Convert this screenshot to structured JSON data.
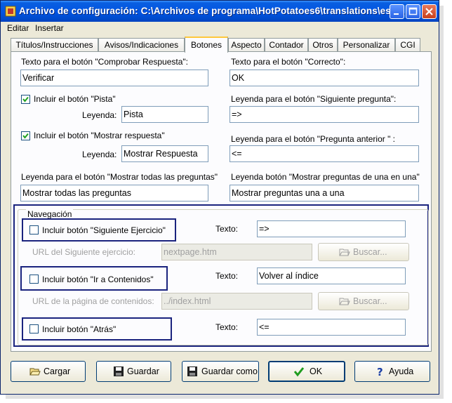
{
  "window": {
    "title": "Archivo de configuración: C:\\Archivos de programa\\HotPotatoes6\\translations\\esp...",
    "controls": [
      "minimize",
      "maximize",
      "close"
    ]
  },
  "menu": {
    "items": [
      "Editar",
      "Insertar"
    ]
  },
  "tabs": [
    {
      "label": "Títulos/Instrucciones"
    },
    {
      "label": "Avisos/Indicaciones"
    },
    {
      "label": "Botones",
      "active": true
    },
    {
      "label": "Aspecto"
    },
    {
      "label": "Contador"
    },
    {
      "label": "Otros"
    },
    {
      "label": "Personalizar"
    },
    {
      "label": "CGI"
    }
  ],
  "buttons_tab": {
    "check_button_label": "Texto para el botón \"Comprobar Respuesta\":",
    "check_button_value": "Verificar",
    "correct_button_label": "Texto para el botón \"Correcto\":",
    "correct_button_value": "OK",
    "hint_checkbox_label": "Incluir el botón \"Pista\"",
    "hint_checked": true,
    "hint_caption_label": "Leyenda:",
    "hint_caption_value": "Pista",
    "next_question_label": "Leyenda para el botón \"Siguiente pregunta\":",
    "next_question_value": "=>",
    "show_answer_checkbox_label": "Incluir el botón \"Mostrar respuesta\"",
    "show_answer_checked": true,
    "show_answer_caption_label": "Leyenda:",
    "show_answer_caption_value": "Mostrar Respuesta",
    "prev_question_label": "Leyenda para el botón \"Pregunta anterior \" :",
    "prev_question_value": "<=",
    "show_all_label": "Leyenda para el botón \"Mostrar todas las preguntas\"",
    "show_all_value": "Mostrar todas las preguntas",
    "show_one_label": "Leyenda botón \"Mostrar preguntas de una en una\"",
    "show_one_value": "Mostrar preguntas una a una"
  },
  "navigation": {
    "group_title": "Navegación",
    "next_exercise_checkbox": "Incluir botón \"Siguiente Ejercicio\"",
    "next_exercise_checked": false,
    "next_exercise_text_label": "Texto:",
    "next_exercise_text_value": "=>",
    "next_exercise_url_label": "URL del Siguiente ejercicio:",
    "next_exercise_url_value": "nextpage.htm",
    "browse_label_1": "Buscar...",
    "contents_checkbox": "Incluir botón \"Ir a Contenidos\"",
    "contents_checked": false,
    "contents_text_label": "Texto:",
    "contents_text_value": "Volver al índice",
    "contents_url_label": "URL de la página de contenidos:",
    "contents_url_value": "../index.html",
    "browse_label_2": "Buscar...",
    "back_checkbox": "Incluir botón \"Atrás\"",
    "back_checked": false,
    "back_text_label": "Texto:",
    "back_text_value": "<="
  },
  "footer": {
    "load_label": "Cargar",
    "save_label": "Guardar",
    "save_as_label": "Guardar como",
    "ok_label": "OK",
    "help_label": "Ayuda"
  }
}
